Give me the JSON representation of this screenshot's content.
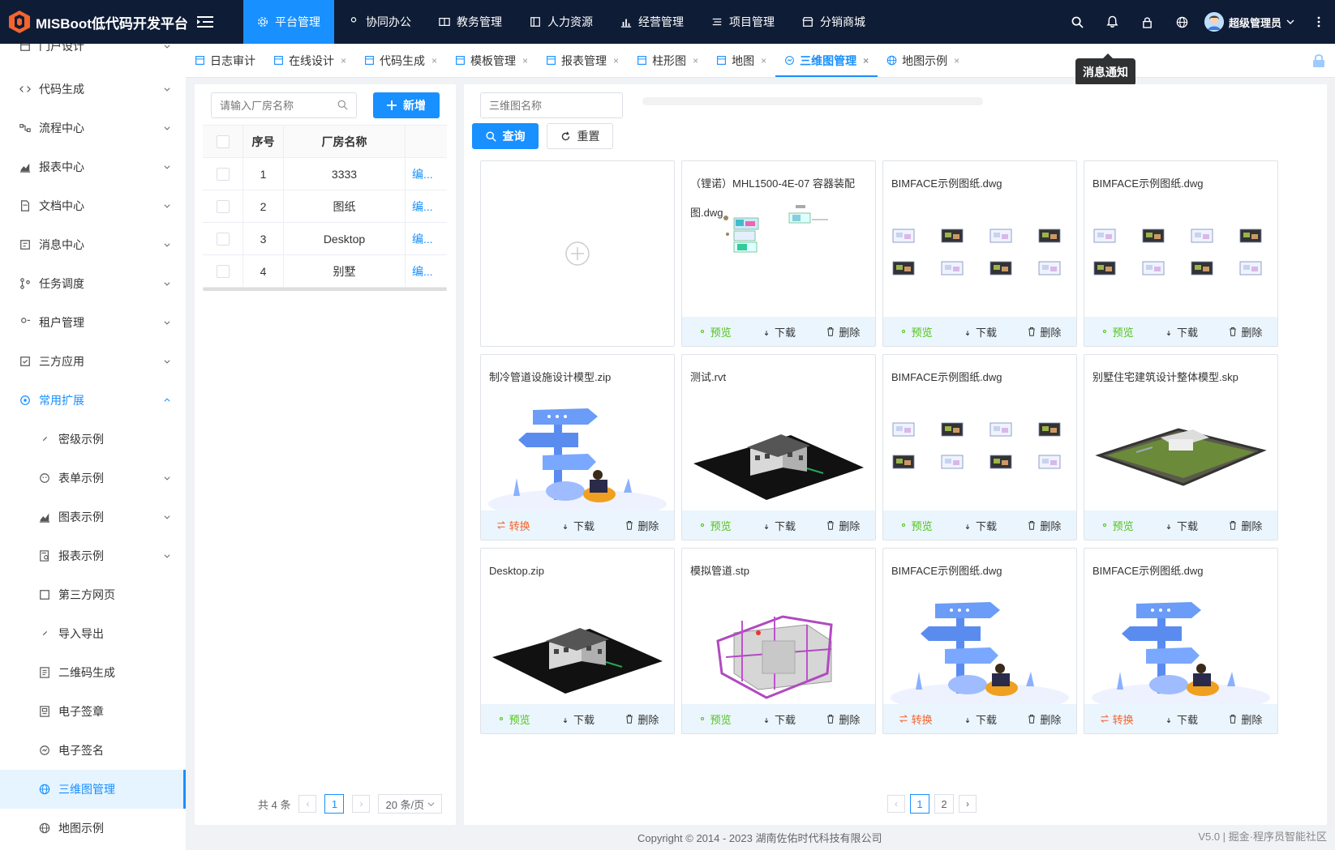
{
  "app": {
    "title": "MISBoot低代码开发平台"
  },
  "topnav": [
    {
      "label": "平台管理",
      "icon": "gear-icon",
      "active": true
    },
    {
      "label": "协同办公",
      "icon": "person-icon",
      "active": false
    },
    {
      "label": "教务管理",
      "icon": "book-icon",
      "active": false
    },
    {
      "label": "人力资源",
      "icon": "panel-icon",
      "active": false
    },
    {
      "label": "经营管理",
      "icon": "bar-chart-icon",
      "active": false
    },
    {
      "label": "项目管理",
      "icon": "list-icon",
      "active": false
    },
    {
      "label": "分销商城",
      "icon": "shop-icon",
      "active": false
    }
  ],
  "user": {
    "name": "超级管理员"
  },
  "tooltip": "消息通知",
  "sidebar": [
    {
      "label": "门户设计",
      "icon": "portal-icon",
      "expandable": true
    },
    {
      "label": "代码生成",
      "icon": "code-icon",
      "expandable": true
    },
    {
      "label": "流程中心",
      "icon": "flow-icon",
      "expandable": true
    },
    {
      "label": "报表中心",
      "icon": "chart-icon",
      "expandable": true
    },
    {
      "label": "文档中心",
      "icon": "doc-icon",
      "expandable": true
    },
    {
      "label": "消息中心",
      "icon": "message-icon",
      "expandable": true
    },
    {
      "label": "任务调度",
      "icon": "task-icon",
      "expandable": true
    },
    {
      "label": "租户管理",
      "icon": "tenant-icon",
      "expandable": true
    },
    {
      "label": "三方应用",
      "icon": "app-icon",
      "expandable": true
    },
    {
      "label": "常用扩展",
      "icon": "extend-icon",
      "expandable": true,
      "open": true
    },
    {
      "label": "密级示例",
      "icon": "clip-icon",
      "sub": true
    },
    {
      "label": "表单示例",
      "icon": "smile-icon",
      "sub": true,
      "expandable": true
    },
    {
      "label": "图表示例",
      "icon": "chart-icon",
      "sub": true,
      "expandable": true
    },
    {
      "label": "报表示例",
      "icon": "report-icon",
      "sub": true,
      "expandable": true
    },
    {
      "label": "第三方网页",
      "icon": "square-icon",
      "sub": true
    },
    {
      "label": "导入导出",
      "icon": "clip-icon",
      "sub": true
    },
    {
      "label": "二维码生成",
      "icon": "qr-icon",
      "sub": true
    },
    {
      "label": "电子签章",
      "icon": "stamp-icon",
      "sub": true
    },
    {
      "label": "电子签名",
      "icon": "sign-icon",
      "sub": true
    },
    {
      "label": "三维图管理",
      "icon": "globe-icon",
      "sub": true,
      "active": true
    },
    {
      "label": "地图示例",
      "icon": "globe-icon",
      "sub": true
    }
  ],
  "tabs": [
    {
      "label": "日志审计",
      "closable": false
    },
    {
      "label": "在线设计",
      "closable": true
    },
    {
      "label": "代码生成",
      "closable": true
    },
    {
      "label": "模板管理",
      "closable": true
    },
    {
      "label": "报表管理",
      "closable": true
    },
    {
      "label": "柱形图",
      "closable": true
    },
    {
      "label": "地图",
      "closable": true
    },
    {
      "label": "三维图管理",
      "closable": true,
      "active": true
    },
    {
      "label": "地图示例",
      "closable": true
    }
  ],
  "left": {
    "search_placeholder": "请输入厂房名称",
    "add_label": "新增",
    "columns": [
      "序号",
      "厂房名称"
    ],
    "rows": [
      {
        "no": "1",
        "name": "3333",
        "op": "编..."
      },
      {
        "no": "2",
        "name": "图纸",
        "op": "编..."
      },
      {
        "no": "3",
        "name": "Desktop",
        "op": "编..."
      },
      {
        "no": "4",
        "name": "别墅",
        "op": "编..."
      }
    ],
    "pager": {
      "total": "共 4 条",
      "page": "1",
      "size": "20 条/页"
    }
  },
  "right": {
    "search_placeholder": "三维图名称",
    "query_label": "查询",
    "reset_label": "重置",
    "cards": [
      {
        "title": "（锂诺）MHL1500-4E-07 容器装配图.dwg",
        "img": "dwg-small",
        "actions": [
          "预览",
          "下载",
          "删除"
        ],
        "first": "preview"
      },
      {
        "title": "BIMFACE示例图纸.dwg",
        "img": "dwg-grid",
        "actions": [
          "预览",
          "下载",
          "删除"
        ],
        "first": "preview"
      },
      {
        "title": "BIMFACE示例图纸.dwg",
        "img": "dwg-grid",
        "actions": [
          "预览",
          "下载",
          "删除"
        ],
        "first": "preview"
      },
      {
        "title": "制冷管道设施设计模型.zip",
        "img": "signpost",
        "actions": [
          "转换",
          "下载",
          "删除"
        ],
        "first": "convert"
      },
      {
        "title": "测试.rvt",
        "img": "house",
        "actions": [
          "预览",
          "下载",
          "删除"
        ],
        "first": "preview"
      },
      {
        "title": "BIMFACE示例图纸.dwg",
        "img": "dwg-grid",
        "actions": [
          "预览",
          "下载",
          "删除"
        ],
        "first": "preview"
      },
      {
        "title": "别墅住宅建筑设计整体模型.skp",
        "img": "villa",
        "actions": [
          "预览",
          "下载",
          "删除"
        ],
        "first": "preview"
      },
      {
        "title": "Desktop.zip",
        "img": "house",
        "actions": [
          "预览",
          "下载",
          "删除"
        ],
        "first": "preview"
      },
      {
        "title": "模拟管道.stp",
        "img": "pipes",
        "actions": [
          "预览",
          "下载",
          "删除"
        ],
        "first": "preview"
      },
      {
        "title": "BIMFACE示例图纸.dwg",
        "img": "signpost",
        "actions": [
          "转换",
          "下载",
          "删除"
        ],
        "first": "convert"
      },
      {
        "title": "BIMFACE示例图纸.dwg",
        "img": "signpost",
        "actions": [
          "转换",
          "下载",
          "删除"
        ],
        "first": "convert"
      }
    ],
    "pager": {
      "pages": [
        "1",
        "2"
      ],
      "current": "1"
    }
  },
  "footer": {
    "copyright": "Copyright © 2014 - 2023 湖南佐佑时代科技有限公司",
    "version": "V5.0 | 掘金·程序员智能社区"
  }
}
